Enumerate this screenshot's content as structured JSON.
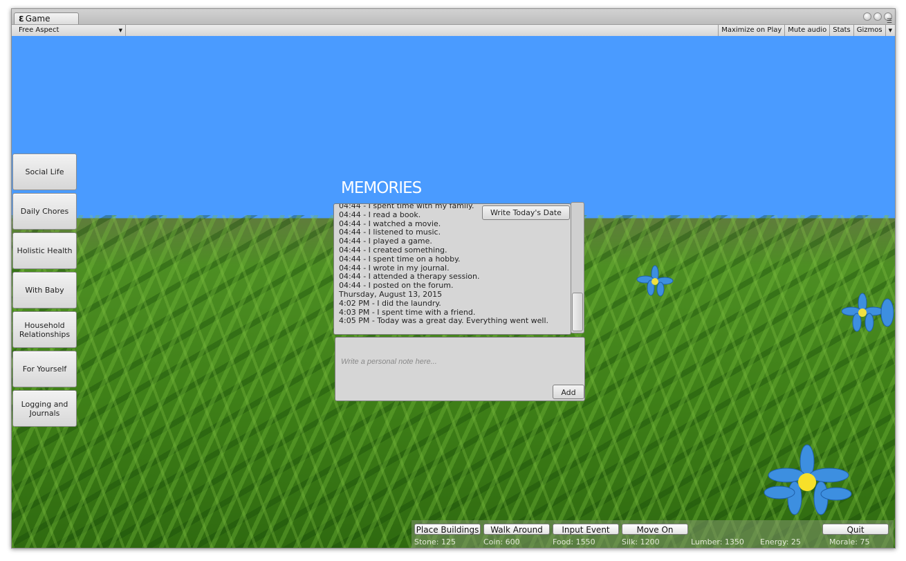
{
  "window": {
    "tab_label": "Game",
    "tab_icon": "unity-logo-icon"
  },
  "toolbar": {
    "aspect": "Free Aspect",
    "maximize": "Maximize on Play",
    "mute": "Mute audio",
    "stats": "Stats",
    "gizmos": "Gizmos"
  },
  "sidebar": {
    "items": [
      {
        "label": "Social Life"
      },
      {
        "label": "Daily Chores"
      },
      {
        "label": "Holistic Health"
      },
      {
        "label": "With Baby"
      },
      {
        "label": "Household Relationships"
      },
      {
        "label": "For Yourself"
      },
      {
        "label": "Logging and Journals"
      }
    ]
  },
  "memories": {
    "title": "MEMORIES",
    "write_date_button": "Write Today's Date",
    "entries": [
      "04:44 - I spent time with my family.",
      "04:44 - I read a book.",
      "04:44 - I watched a movie.",
      "04:44 - I listened to music.",
      "04:44 - I played a game.",
      "04:44 - I created something.",
      "04:44 - I spent time on a hobby.",
      "04:44 - I wrote in my journal.",
      "04:44 - I attended a therapy session.",
      "04:44 - I posted on the forum.",
      "Thursday, August 13, 2015",
      "4:02 PM - I did the laundry.",
      "4:03 PM - I spent time with a friend.",
      "4:05 PM - Today was a great day. Everything went well."
    ],
    "note_placeholder": "Write a personal note here...",
    "note_value": "",
    "add_button": "Add"
  },
  "bottom_bar": {
    "buttons": {
      "place_buildings": "Place Buildings",
      "walk_around": "Walk Around",
      "input_event": "Input Event",
      "move_on": "Move On",
      "quit": "Quit"
    },
    "resources": {
      "stone": "Stone: 125",
      "coin": "Coin: 600",
      "food": "Food: 1550",
      "silk": "Silk: 1200",
      "lumber": "Lumber: 1350",
      "energy": "Energy: 25",
      "morale": "Morale: 75"
    }
  },
  "colors": {
    "sky": "#4a9bff",
    "grass": "#3f8018",
    "panel": "#d6d6d6"
  }
}
